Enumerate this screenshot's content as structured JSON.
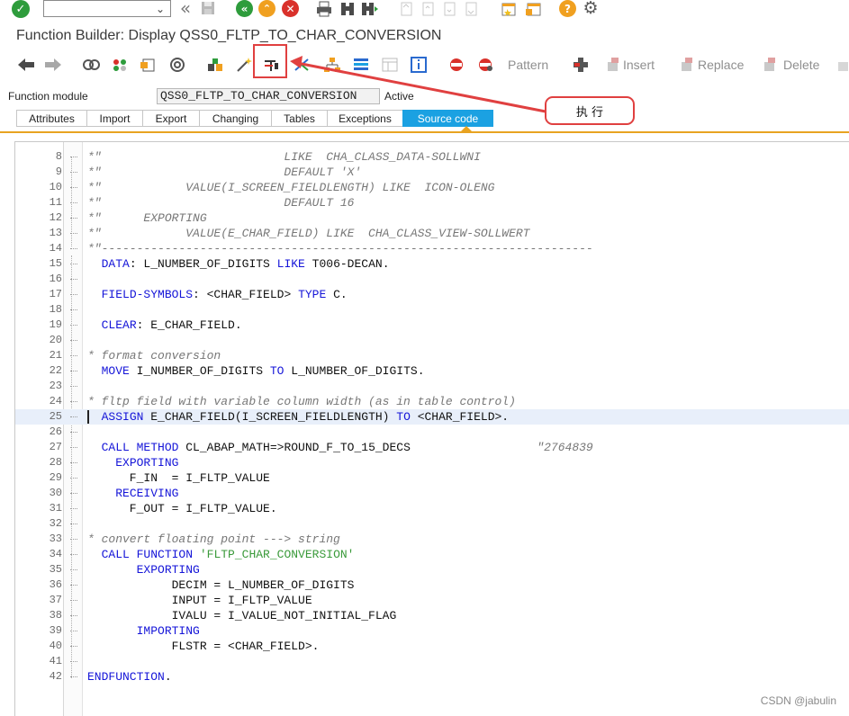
{
  "system_toolbar": {
    "command_value": "",
    "icons": [
      "enter-icon",
      "back-icon",
      "save-icon",
      "back-green-icon",
      "exit-icon",
      "cancel-icon",
      "print-icon",
      "find-icon",
      "find-next-icon",
      "first-page-icon",
      "prev-page-icon",
      "next-page-icon",
      "last-page-icon",
      "new-session-icon",
      "shortcut-icon",
      "help-icon",
      "customize-icon"
    ]
  },
  "title": "Function Builder: Display QSS0_FLTP_TO_CHAR_CONVERSION",
  "app_toolbar": {
    "pattern_label": "Pattern",
    "insert_label": "Insert",
    "replace_label": "Replace",
    "delete_label": "Delete"
  },
  "header": {
    "function_module_label": "Function module",
    "function_module_value": "QSS0_FLTP_TO_CHAR_CONVERSION",
    "status": "Active"
  },
  "tabs": [
    {
      "label": "Attributes",
      "active": false
    },
    {
      "label": "Import",
      "active": false
    },
    {
      "label": "Export",
      "active": false
    },
    {
      "label": "Changing",
      "active": false
    },
    {
      "label": "Tables",
      "active": false
    },
    {
      "label": "Exceptions",
      "active": false
    },
    {
      "label": "Source code",
      "active": true
    }
  ],
  "annotation": {
    "callout_text": "执 行",
    "color": "#e04040"
  },
  "code_lines": [
    {
      "n": "8",
      "segs": [
        [
          "cm",
          "*\"                          LIKE  CHA_CLASS_DATA-SOLLWNI"
        ]
      ]
    },
    {
      "n": "9",
      "segs": [
        [
          "cm",
          "*\"                          DEFAULT 'X'"
        ]
      ]
    },
    {
      "n": "10",
      "segs": [
        [
          "cm",
          "*\"            VALUE(I_SCREEN_FIELDLENGTH) LIKE  ICON-OLENG"
        ]
      ]
    },
    {
      "n": "11",
      "segs": [
        [
          "cm",
          "*\"                          DEFAULT 16"
        ]
      ]
    },
    {
      "n": "12",
      "segs": [
        [
          "cm",
          "*\"      EXPORTING"
        ]
      ]
    },
    {
      "n": "13",
      "segs": [
        [
          "cm",
          "*\"            VALUE(E_CHAR_FIELD) LIKE  CHA_CLASS_VIEW-SOLLWERT"
        ]
      ]
    },
    {
      "n": "14",
      "segs": [
        [
          "cm",
          "*\"----------------------------------------------------------------------"
        ]
      ]
    },
    {
      "n": "15",
      "segs": [
        [
          "tx",
          "  "
        ],
        [
          "kw",
          "DATA"
        ],
        [
          "tx",
          ": L_NUMBER_OF_DIGITS "
        ],
        [
          "kw",
          "LIKE"
        ],
        [
          "tx",
          " T006-DECAN."
        ]
      ]
    },
    {
      "n": "16",
      "segs": []
    },
    {
      "n": "17",
      "segs": [
        [
          "tx",
          "  "
        ],
        [
          "kw",
          "FIELD-SYMBOLS"
        ],
        [
          "tx",
          ": <CHAR_FIELD> "
        ],
        [
          "kw",
          "TYPE"
        ],
        [
          "tx",
          " C."
        ]
      ]
    },
    {
      "n": "18",
      "segs": []
    },
    {
      "n": "19",
      "segs": [
        [
          "tx",
          "  "
        ],
        [
          "kw",
          "CLEAR"
        ],
        [
          "tx",
          ": E_CHAR_FIELD."
        ]
      ]
    },
    {
      "n": "20",
      "segs": []
    },
    {
      "n": "21",
      "segs": [
        [
          "cm",
          "* format conversion"
        ]
      ]
    },
    {
      "n": "22",
      "segs": [
        [
          "tx",
          "  "
        ],
        [
          "kw",
          "MOVE"
        ],
        [
          "tx",
          " I_NUMBER_OF_DIGITS "
        ],
        [
          "kw",
          "TO"
        ],
        [
          "tx",
          " L_NUMBER_OF_DIGITS."
        ]
      ]
    },
    {
      "n": "23",
      "segs": []
    },
    {
      "n": "24",
      "segs": [
        [
          "cm",
          "* fltp field with variable column width (as in table control)"
        ]
      ]
    },
    {
      "n": "25",
      "cur": true,
      "segs": [
        [
          "tx",
          "  "
        ],
        [
          "kw",
          "ASSIGN"
        ],
        [
          "tx",
          " E_CHAR_FIELD(I_SCREEN_FIELDLENGTH) "
        ],
        [
          "kw",
          "TO"
        ],
        [
          "tx",
          " <CHAR_FIELD>."
        ]
      ]
    },
    {
      "n": "26",
      "segs": []
    },
    {
      "n": "27",
      "segs": [
        [
          "tx",
          "  "
        ],
        [
          "kw",
          "CALL METHOD"
        ],
        [
          "tx",
          " CL_ABAP_MATH=>ROUND_F_TO_15_DECS                  "
        ],
        [
          "cm",
          "\"2764839"
        ]
      ]
    },
    {
      "n": "28",
      "segs": [
        [
          "tx",
          "    "
        ],
        [
          "kw",
          "EXPORTING"
        ]
      ]
    },
    {
      "n": "29",
      "segs": [
        [
          "tx",
          "      F_IN  = I_FLTP_VALUE"
        ]
      ]
    },
    {
      "n": "30",
      "segs": [
        [
          "tx",
          "    "
        ],
        [
          "kw",
          "RECEIVING"
        ]
      ]
    },
    {
      "n": "31",
      "segs": [
        [
          "tx",
          "      F_OUT = I_FLTP_VALUE."
        ]
      ]
    },
    {
      "n": "32",
      "segs": []
    },
    {
      "n": "33",
      "segs": [
        [
          "cm",
          "* convert floating point ---> string"
        ]
      ]
    },
    {
      "n": "34",
      "segs": [
        [
          "tx",
          "  "
        ],
        [
          "kw",
          "CALL FUNCTION"
        ],
        [
          "tx",
          " "
        ],
        [
          "st",
          "'FLTP_CHAR_CONVERSION'"
        ]
      ]
    },
    {
      "n": "35",
      "segs": [
        [
          "tx",
          "       "
        ],
        [
          "kw",
          "EXPORTING"
        ]
      ]
    },
    {
      "n": "36",
      "segs": [
        [
          "tx",
          "            DECIM = L_NUMBER_OF_DIGITS"
        ]
      ]
    },
    {
      "n": "37",
      "segs": [
        [
          "tx",
          "            INPUT = I_FLTP_VALUE"
        ]
      ]
    },
    {
      "n": "38",
      "segs": [
        [
          "tx",
          "            IVALU = I_VALUE_NOT_INITIAL_FLAG"
        ]
      ]
    },
    {
      "n": "39",
      "segs": [
        [
          "tx",
          "       "
        ],
        [
          "kw",
          "IMPORTING"
        ]
      ]
    },
    {
      "n": "40",
      "segs": [
        [
          "tx",
          "            FLSTR = <CHAR_FIELD>."
        ]
      ]
    },
    {
      "n": "41",
      "segs": []
    },
    {
      "n": "42",
      "segs": [
        [
          "kw",
          "ENDFUNCTION"
        ],
        [
          "tx",
          "."
        ]
      ]
    }
  ],
  "watermark": "CSDN @jabulin"
}
